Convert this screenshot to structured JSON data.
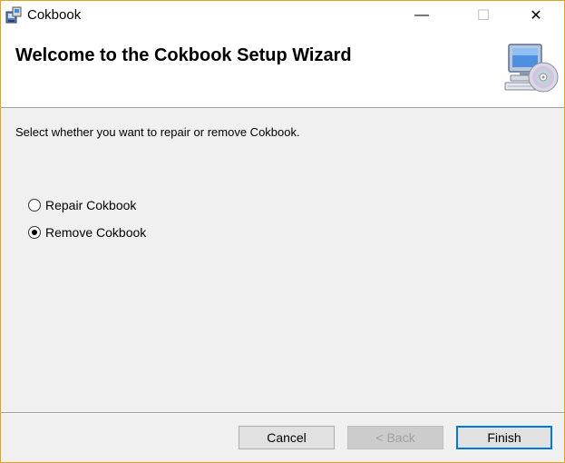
{
  "window": {
    "title": "Cokbook",
    "controls": {
      "minimize": "—",
      "maximize": "☐",
      "close": "✕"
    }
  },
  "header": {
    "title": "Welcome to the Cokbook Setup Wizard"
  },
  "body": {
    "instruction": "Select whether you want to repair or remove Cokbook.",
    "options": [
      {
        "label": "Repair Cokbook",
        "selected": false
      },
      {
        "label": "Remove Cokbook",
        "selected": true
      }
    ]
  },
  "footer": {
    "cancel_label": "Cancel",
    "back_label": "< Back",
    "finish_label": "Finish"
  },
  "colors": {
    "window_border": "#e3a21a",
    "focus_border": "#0078d7",
    "background": "#f0f0f0"
  }
}
